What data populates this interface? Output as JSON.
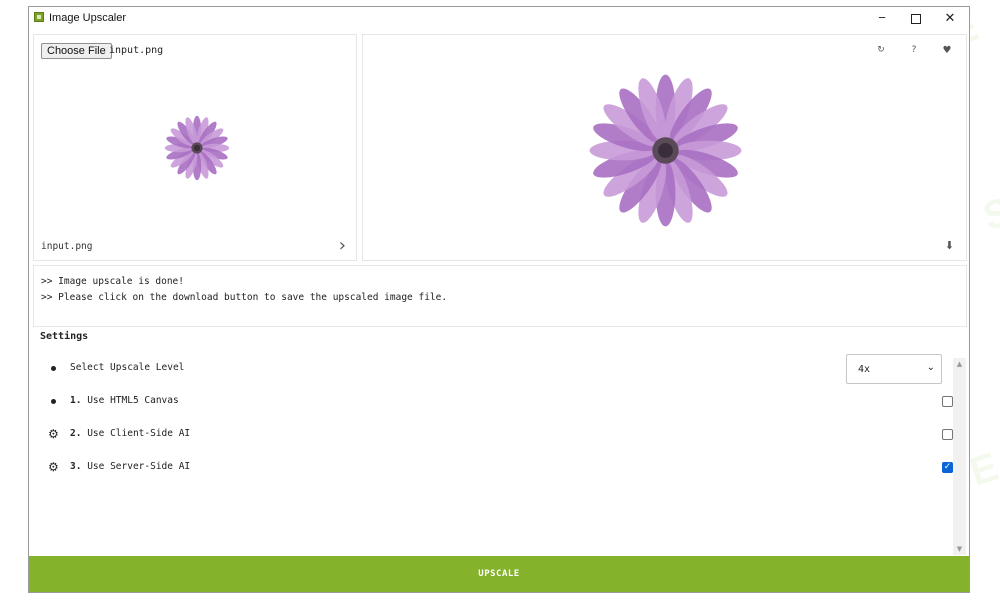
{
  "window": {
    "title": "Image Upscaler",
    "controls": {
      "minimize": "−",
      "maximize": "",
      "close": "✕"
    }
  },
  "input_panel": {
    "choose_file_label": "Choose File",
    "file_name": "input.png",
    "caption": "input.png",
    "next_icon": "›"
  },
  "output_panel": {
    "icons": {
      "refresh": "↻",
      "help": "?",
      "favorite": "♥",
      "download": "⬇"
    }
  },
  "log": {
    "lines": [
      ">> Image upscale is done!",
      ">> Please click on the download button to save the upscaled image file."
    ]
  },
  "settings": {
    "title": "Settings",
    "level": {
      "label": "Select Upscale Level",
      "selected": "4x"
    },
    "options": [
      {
        "num": "1.",
        "label": "Use HTML5 Canvas",
        "icon": "bullet",
        "checked": false
      },
      {
        "num": "2.",
        "label": "Use Client-Side AI",
        "icon": "gear-icon",
        "checked": false
      },
      {
        "num": "3.",
        "label": "Use Server-Side AI",
        "icon": "gear-icon",
        "checked": true
      }
    ]
  },
  "upscale_button": "UPSCALE",
  "watermark_text": "AI TALENT SPACE",
  "colors": {
    "accent": "#84b22b",
    "checkbox_checked": "#0a64d6",
    "flower_petal": "#b98ad0",
    "flower_center": "#5a4a58"
  }
}
